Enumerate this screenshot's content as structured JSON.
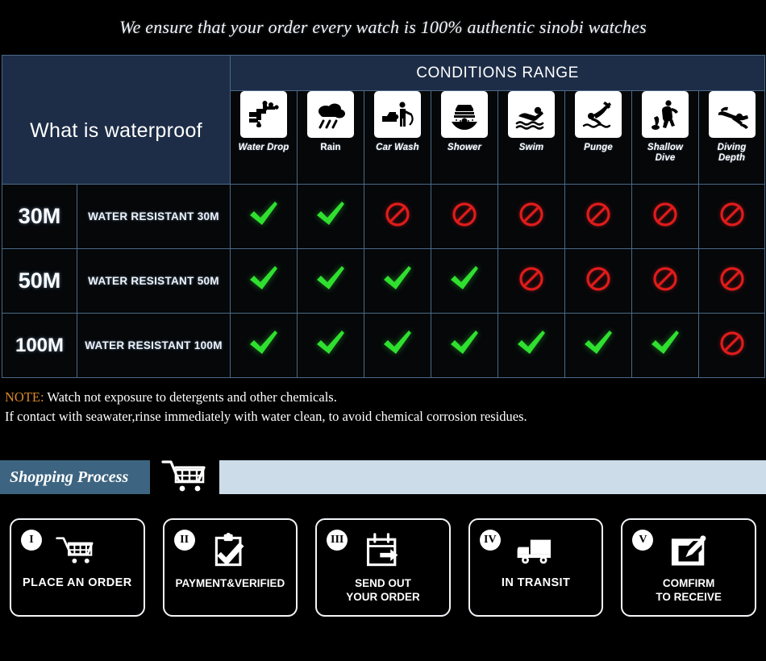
{
  "banner": {
    "text": "We ensure that your order every watch is 100% authentic sinobi watches"
  },
  "table": {
    "header_title": "What is waterproof",
    "conditions_range_label": "CONDITIONS RANGE",
    "conditions": [
      {
        "label": "Water Drop",
        "icon": "faucet-drip-icon",
        "italic": true
      },
      {
        "label": "Rain",
        "icon": "rain-cloud-icon",
        "italic": false
      },
      {
        "label": "Car Wash",
        "icon": "car-wash-icon",
        "italic": true
      },
      {
        "label": "Shower",
        "icon": "shower-icon",
        "italic": true
      },
      {
        "label": "Swim",
        "icon": "swimmer-icon",
        "italic": true
      },
      {
        "label": "Punge",
        "icon": "plunge-dive-icon",
        "italic": true
      },
      {
        "label": "Shallow\nDive",
        "icon": "shallow-diver-icon",
        "italic": true
      },
      {
        "label": "Diving\nDepth",
        "icon": "scuba-diver-icon",
        "italic": true
      }
    ],
    "rows": [
      {
        "depth": "30M",
        "resistance": "WATER RESISTANT  30M",
        "marks": [
          "yes",
          "yes",
          "no",
          "no",
          "no",
          "no",
          "no",
          "no"
        ]
      },
      {
        "depth": "50M",
        "resistance": "WATER RESISTANT 50M",
        "marks": [
          "yes",
          "yes",
          "yes",
          "yes",
          "no",
          "no",
          "no",
          "no"
        ]
      },
      {
        "depth": "100M",
        "resistance": "WATER RESISTANT  100M",
        "marks": [
          "yes",
          "yes",
          "yes",
          "yes",
          "yes",
          "yes",
          "yes",
          "no"
        ]
      }
    ]
  },
  "note": {
    "keyword": "NOTE:",
    "line1": " Watch not exposure to detergents and other chemicals.",
    "line2": "If contact with seawater,rinse immediately with water clean, to avoid chemical corrosion residues."
  },
  "shopping_process": {
    "label": "Shopping Process",
    "cart_icon": "shopping-cart-icon",
    "steps": [
      {
        "numeral": "I",
        "label": "PLACE AN ORDER",
        "icon": "shopping-cart-icon"
      },
      {
        "numeral": "II",
        "label": "PAYMENT&VERIFIED",
        "icon": "clipboard-check-icon"
      },
      {
        "numeral": "III",
        "label": "SEND OUT\nYOUR ORDER",
        "icon": "calendar-arrow-icon"
      },
      {
        "numeral": "IV",
        "label": "IN TRANSIT",
        "icon": "delivery-truck-icon"
      },
      {
        "numeral": "V",
        "label": "COMFIRM\nTO RECEIVE",
        "icon": "sign-document-icon"
      }
    ]
  },
  "colors": {
    "header_navy": "#1d2d47",
    "grid_line": "#4a6a88",
    "cell_black": "#050709",
    "tick_green": "#2fe02f",
    "ban_red": "#e01b1b",
    "note_keyword_orange": "#d9882c",
    "steel_blue": "#3d6480",
    "light_blue_strip": "#ccdce8"
  }
}
